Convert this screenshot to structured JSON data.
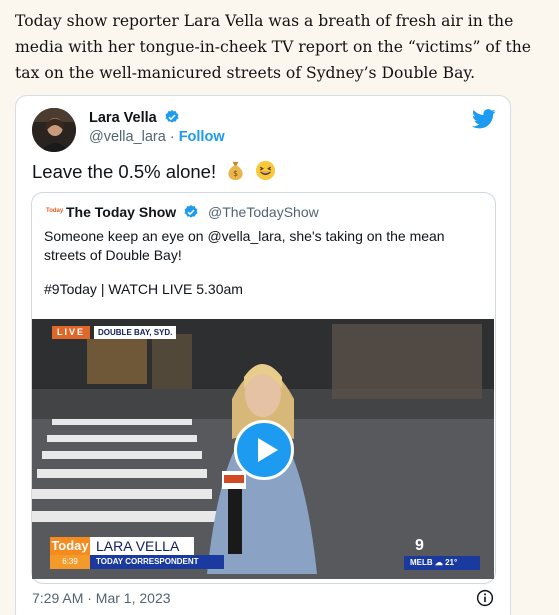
{
  "article": {
    "paragraph": "Today show reporter Lara Vella was a breath of fresh air in the media with her tongue-in-cheek TV report on the “victims” of the tax on the well-manicured streets of Sydney’s Double Bay."
  },
  "tweet": {
    "author_name": "Lara Vella",
    "author_handle": "@vella_lara",
    "separator": " · ",
    "follow_label": "Follow",
    "text": "Leave the 0.5% alone!",
    "timestamp": "7:29 AM · Mar 1, 2023",
    "icons": [
      "verified-icon",
      "twitter-bird-icon",
      "money-bag-icon",
      "grinning-squint-icon",
      "info-icon"
    ],
    "colors": {
      "accent": "#1d9bf0",
      "verified": "#1d9bf0"
    }
  },
  "quoted_tweet": {
    "logo_text": "Today",
    "author_name": "The Today Show",
    "author_handle": "@TheTodayShow",
    "text": "Someone keep an eye on @vella_lara, she's taking on the mean streets of Double Bay!",
    "tags": "#9Today | WATCH LIVE 5.30am"
  },
  "video": {
    "live_label": "LIVE",
    "location_label": "DOUBLE BAY, SYD.",
    "show_label": "Today",
    "time_label": "6:39",
    "reporter_name": "LARA VELLA",
    "reporter_title": "TODAY CORRESPONDENT",
    "channel_logo": "9",
    "weather_label": "MELB ☁ 21°",
    "mic_label": "Today",
    "colors": {
      "play_button": "#1d9bf0",
      "lower_third": "#1a3aa0",
      "brand_orange": "#f58b1f"
    }
  }
}
